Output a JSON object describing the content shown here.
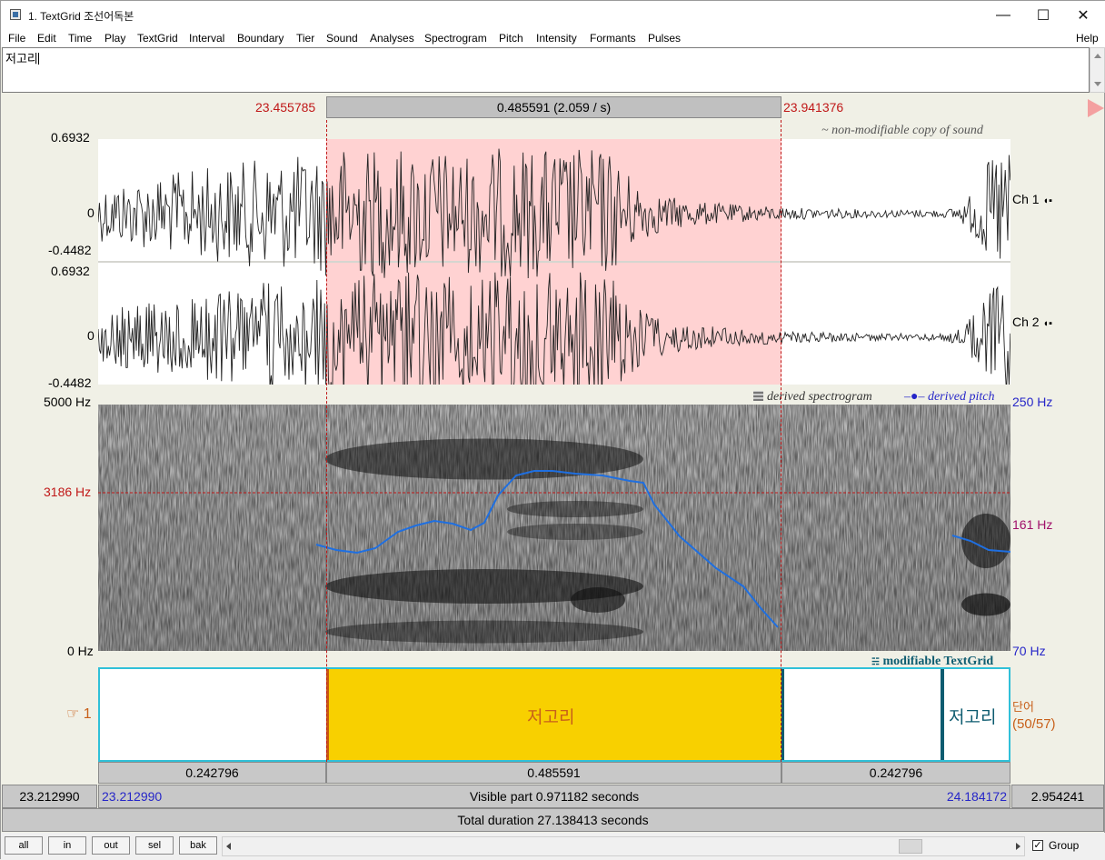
{
  "window": {
    "title": "1. TextGrid 조선어독본",
    "minimize_glyph": "—",
    "maximize_glyph": "☐",
    "close_glyph": "✕"
  },
  "menu": [
    "File",
    "Edit",
    "Time",
    "Play",
    "TextGrid",
    "Interval",
    "Boundary",
    "Tier",
    "Sound",
    "Analyses",
    "Spectrogram",
    "Pitch",
    "Intensity",
    "Formants",
    "Pulses"
  ],
  "menu_help": "Help",
  "text_area": {
    "value": "저고리"
  },
  "selection": {
    "start": "23.455785",
    "end": "23.941376",
    "duration_label": "0.485591 (2.059 / s)"
  },
  "sound": {
    "caption": "~ non-modifiable copy of sound",
    "channels": [
      {
        "name": "Ch 1",
        "max": "0.6932",
        "zero": "0",
        "min": "-0.4482"
      },
      {
        "name": "Ch 2",
        "max": "0.6932",
        "zero": "0",
        "min": "-0.4482"
      }
    ]
  },
  "spectrogram": {
    "legend_spectrogram": "derived spectrogram",
    "legend_pitch": "derived pitch",
    "freq_top": "5000 Hz",
    "freq_cursor": "3186 Hz",
    "freq_bottom": "0 Hz",
    "pitch_top": "250 Hz",
    "pitch_mid": "161 Hz",
    "pitch_bottom": "70 Hz",
    "colors": {
      "pitch_line": "#1f6fe0",
      "cursor": "#c01818"
    }
  },
  "textgrid": {
    "caption": "modifiable TextGrid",
    "tier_number": "1",
    "tier_name": "단어",
    "tier_count": "(50/57)",
    "selected_interval_text": "저고리",
    "last_interval_text": "저고리",
    "colors": {
      "selected_fill": "#f8d000",
      "tier_border": "#30c0d8",
      "boundary": "#0e5c70"
    }
  },
  "durations": {
    "left": "0.242796",
    "selected": "0.485591",
    "right": "0.242796"
  },
  "window_range": {
    "abs_start": "23.212990",
    "vis_start": "23.212990",
    "visible_part": "Visible part 0.971182 seconds",
    "vis_end": "24.184172",
    "abs_end": "2.954241",
    "total_duration": "Total duration 27.138413 seconds"
  },
  "nav_buttons": [
    "all",
    "in",
    "out",
    "sel",
    "bak"
  ],
  "group_checkbox": {
    "label": "Group",
    "checked": true,
    "mark": "✓"
  }
}
